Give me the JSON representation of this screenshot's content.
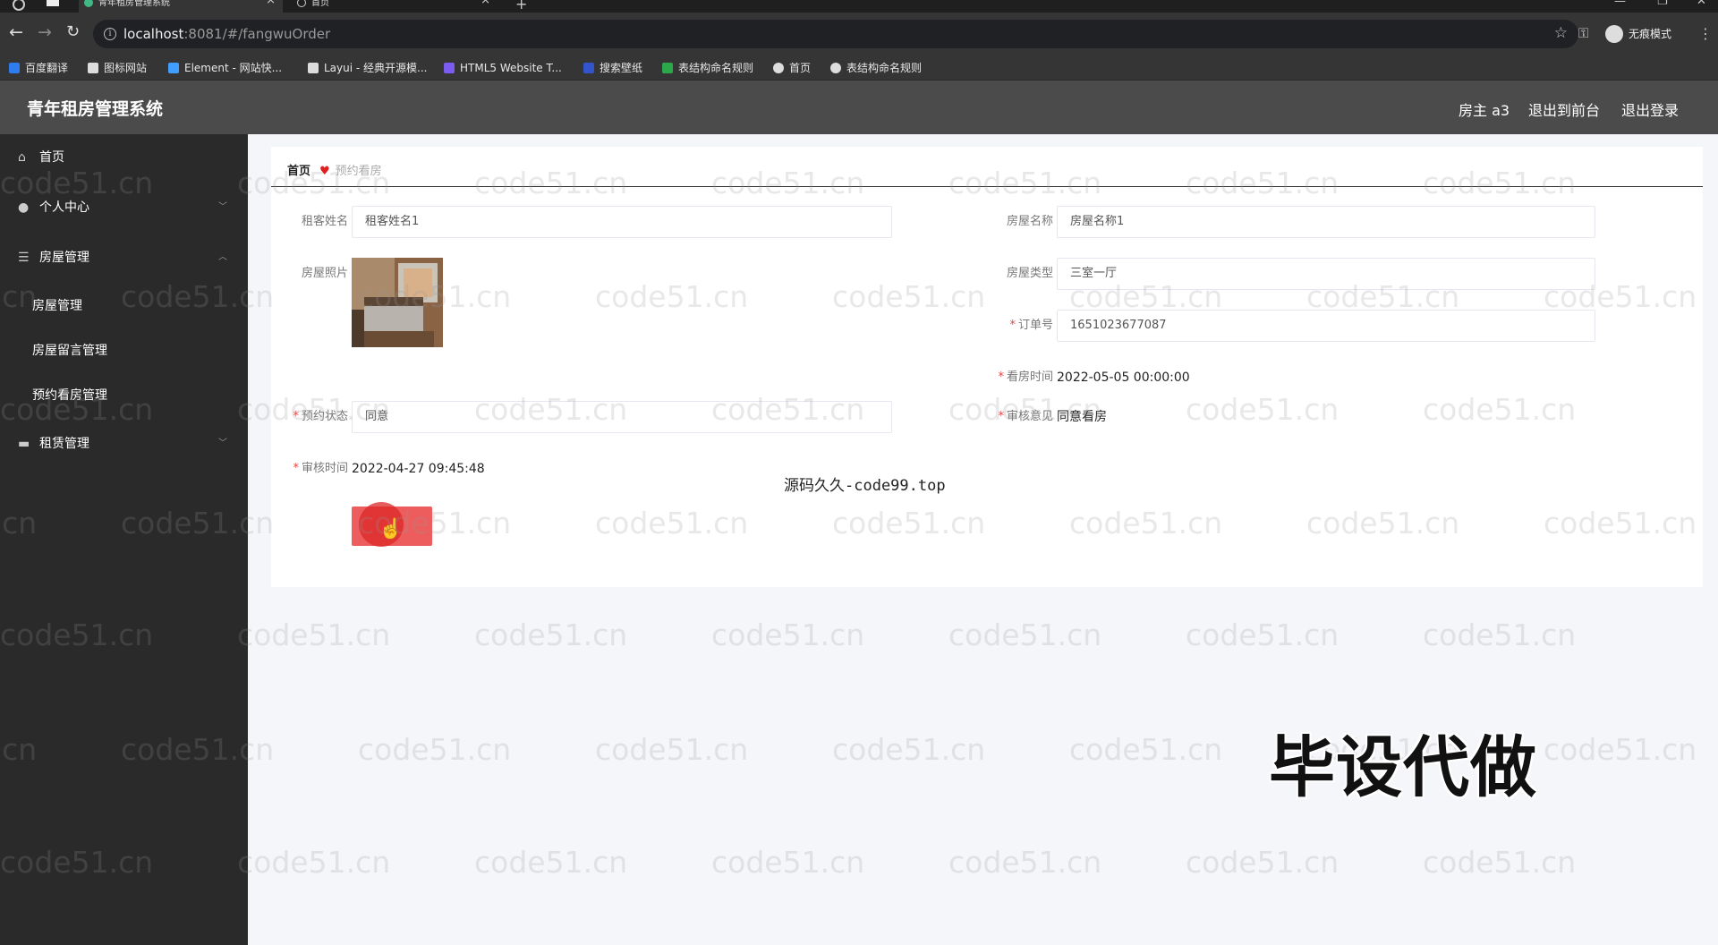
{
  "browser": {
    "tabs": [
      {
        "title": "青年租房管理系统",
        "active": true
      },
      {
        "title": "首页",
        "active": false
      }
    ],
    "url_host": "localhost",
    "url_rest": ":8081/#/fangwuOrder",
    "profile_label": "无痕模式",
    "bookmarks": [
      {
        "label": "百度翻译",
        "color": "#2d7cf0"
      },
      {
        "label": "图标网站",
        "color": "#dddddd"
      },
      {
        "label": "Element - 网站快...",
        "color": "#409eff"
      },
      {
        "label": "Layui - 经典开源模...",
        "color": "#dddddd"
      },
      {
        "label": "HTML5 Website T...",
        "color": "#7a5cf0"
      },
      {
        "label": "搜索壁纸",
        "color": "#3355cc"
      },
      {
        "label": "表结构命名规则",
        "color": "#2aa84a"
      },
      {
        "label": "首页",
        "color": "#dddddd"
      },
      {
        "label": "表结构命名规则",
        "color": "#dddddd"
      }
    ]
  },
  "header": {
    "title": "青年租房管理系统",
    "user_label": "房主 a3",
    "front_label": "退出到前台",
    "logout_label": "退出登录"
  },
  "sidebar": {
    "items": [
      {
        "label": "首页",
        "icon": "home-icon"
      },
      {
        "label": "个人中心",
        "icon": "user-icon"
      },
      {
        "label": "房屋管理",
        "icon": "sliders-icon"
      },
      {
        "label": "租赁管理",
        "icon": "briefcase-icon"
      }
    ],
    "sub_items": [
      "房屋管理",
      "房屋留言管理",
      "预约看房管理"
    ]
  },
  "breadcrumb": {
    "home": "首页",
    "current": "预约看房"
  },
  "form": {
    "tenant_name_label": "租客姓名",
    "tenant_name_value": "租客姓名1",
    "house_name_label": "房屋名称",
    "house_name_value": "房屋名称1",
    "house_photo_label": "房屋照片",
    "house_type_label": "房屋类型",
    "house_type_value": "三室一厅",
    "order_no_label": "订单号",
    "order_no_value": "1651023677087",
    "view_time_label": "看房时间",
    "view_time_value": "2022-05-05 00:00:00",
    "booking_status_label": "预约状态",
    "booking_status_value": "同意",
    "review_opinion_label": "审核意见",
    "review_opinion_value": "同意看房",
    "review_time_label": "审核时间",
    "review_time_value": "2022-04-27 09:45:48"
  },
  "overlay": {
    "code_text": "源码久久-code99.top",
    "big_text": "毕设代做",
    "watermark": "code51.cn"
  },
  "colors": {
    "sidebar_bg": "#2a2a2a",
    "header_bg": "#4b4b4b",
    "button_red": "#ee5d5d",
    "required_star": "#e64545"
  }
}
